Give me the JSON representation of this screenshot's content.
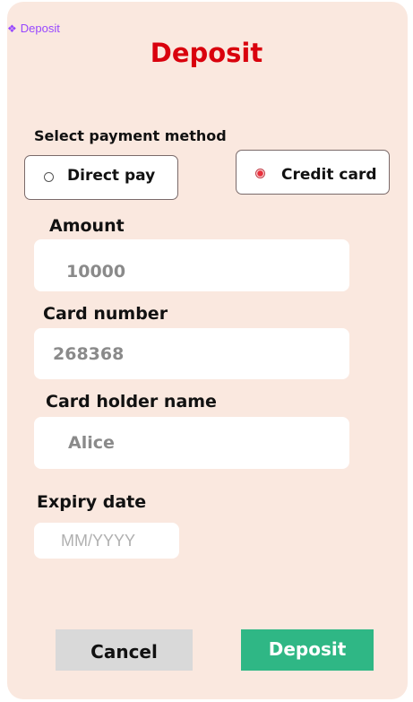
{
  "frame_tag": {
    "label": "Deposit",
    "icon": "component-diamond-icon"
  },
  "title": "Deposit",
  "payment": {
    "label": "Select payment method",
    "options": [
      {
        "label": "Direct pay",
        "selected": false
      },
      {
        "label": "Credit card",
        "selected": true
      }
    ]
  },
  "fields": {
    "amount": {
      "label": "Amount",
      "value": "10000"
    },
    "card_number": {
      "label": "Card number",
      "value": "268368"
    },
    "holder": {
      "label": "Card holder name",
      "value": "Alice"
    },
    "expiry": {
      "label": "Expiry date",
      "placeholder": "MM/YYYY",
      "value": ""
    }
  },
  "buttons": {
    "cancel": "Cancel",
    "deposit": "Deposit"
  },
  "colors": {
    "background": "#fae8df",
    "title": "#d9000d",
    "primary_button": "#2fb785",
    "secondary_button": "#d9d9d9",
    "radio_selected": "#e8303c"
  }
}
